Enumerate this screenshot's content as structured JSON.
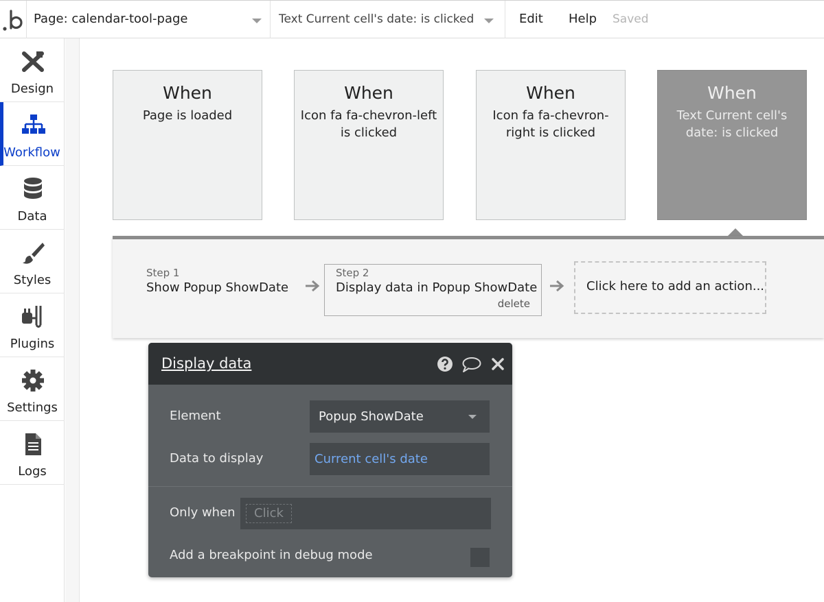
{
  "topbar": {
    "page_label": "Page: calendar-tool-page",
    "event_label": "Text Current cell's date: is clicked",
    "edit_label": "Edit",
    "help_label": "Help",
    "saved_label": "Saved"
  },
  "sidebar": {
    "items": [
      {
        "label": "Design",
        "icon": "design-icon"
      },
      {
        "label": "Workflow",
        "icon": "workflow-icon",
        "active": true
      },
      {
        "label": "Data",
        "icon": "database-icon"
      },
      {
        "label": "Styles",
        "icon": "brush-icon"
      },
      {
        "label": "Plugins",
        "icon": "plug-icon"
      },
      {
        "label": "Settings",
        "icon": "gear-icon"
      },
      {
        "label": "Logs",
        "icon": "document-icon"
      }
    ],
    "active_color": "#0b3ec9"
  },
  "events": [
    {
      "when": "When",
      "desc": "Page is loaded"
    },
    {
      "when": "When",
      "desc": "Icon fa fa-chevron-left is clicked"
    },
    {
      "when": "When",
      "desc": "Icon fa fa-chevron-right is clicked"
    },
    {
      "when": "When",
      "desc": "Text Current cell's date: is clicked",
      "selected": true
    }
  ],
  "steps": [
    {
      "num": "Step 1",
      "name": "Show Popup ShowDate"
    },
    {
      "num": "Step 2",
      "name": "Display data in Popup ShowDate",
      "delete_label": "delete"
    }
  ],
  "add_action_label": "Click here to add an action...",
  "editor": {
    "title": "Display data",
    "element_label": "Element",
    "element_value": "Popup ShowDate",
    "data_label": "Data to display",
    "data_value": "Current cell's date",
    "only_when_label": "Only when",
    "only_when_placeholder": "Click",
    "breakpoint_label": "Add a breakpoint in debug mode"
  }
}
